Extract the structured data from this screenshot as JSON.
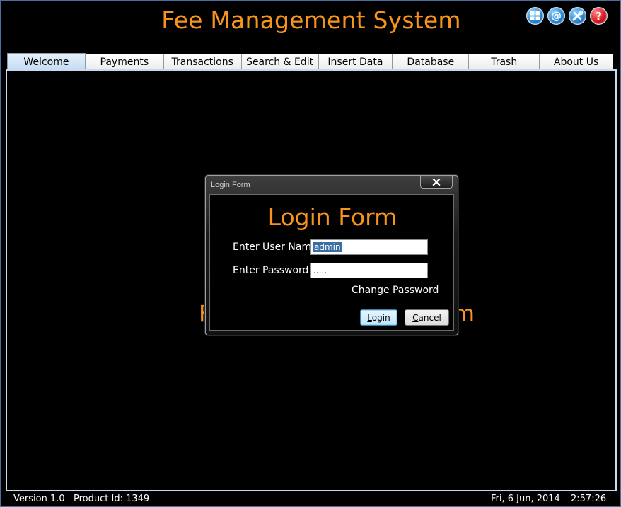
{
  "app": {
    "title": "Fee Management System"
  },
  "toolbar": {
    "icons": [
      "grid-icon",
      "email-icon",
      "tools-icon",
      "help-icon"
    ]
  },
  "tabs": [
    {
      "pre": "",
      "key": "W",
      "post": "elcome",
      "active": true
    },
    {
      "pre": "Pa",
      "key": "y",
      "post": "ments",
      "active": false
    },
    {
      "pre": "",
      "key": "T",
      "post": "ransactions",
      "active": false
    },
    {
      "pre": "",
      "key": "S",
      "post": "earch & Edit",
      "active": false
    },
    {
      "pre": "",
      "key": "I",
      "post": "nsert Data",
      "active": false
    },
    {
      "pre": "",
      "key": "D",
      "post": "atabase",
      "active": false
    },
    {
      "pre": "T",
      "key": "r",
      "post": "ash",
      "active": false
    },
    {
      "pre": "",
      "key": "A",
      "post": "bout Us",
      "active": false
    }
  ],
  "background": {
    "partial_left": "F",
    "partial_right": "m"
  },
  "dialog": {
    "caption": "Login Form",
    "heading": "Login Form",
    "username_label": "Enter User Name",
    "username_value": "admin",
    "password_label": "Enter Password",
    "password_value": ".....",
    "change_password": "Change Password",
    "login_button": {
      "key": "L",
      "post": "ogin"
    },
    "cancel_button": {
      "key": "C",
      "post": "ancel"
    }
  },
  "status": {
    "version": "Version 1.0   Product Id: 1349",
    "date": "Fri, 6 Jun, 2014",
    "time": "2:57:26"
  },
  "colors": {
    "accent": "#f7941d",
    "background": "#000000",
    "selection": "#3a6ea5"
  }
}
